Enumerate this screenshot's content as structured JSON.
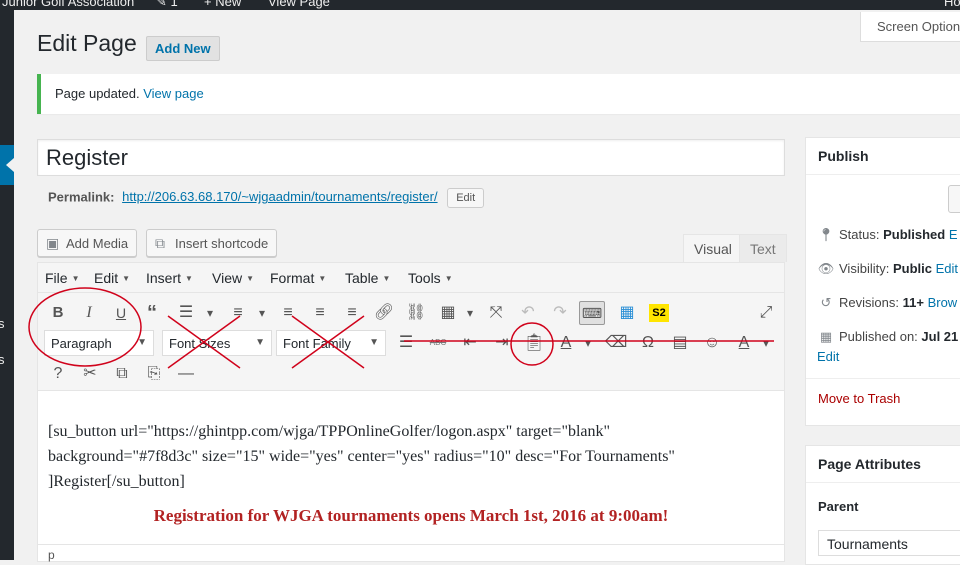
{
  "admin_bar": {
    "site_name": "Junior Golf Association",
    "comments_count": "1",
    "new_label": "New",
    "view_page_label": "View Page",
    "howdy": "Ho"
  },
  "admin_menu": {
    "cut_labels": [
      "s",
      "s"
    ]
  },
  "screen_options": "Screen Options",
  "page": {
    "title": "Edit Page",
    "add_new": "Add New"
  },
  "notice": {
    "text": "Page updated.",
    "link": "View page"
  },
  "post": {
    "title": "Register"
  },
  "permalink": {
    "label": "Permalink:",
    "url": "http://206.63.68.170/~wjgaadmin/tournaments/register/",
    "edit_label": "Edit"
  },
  "media_buttons": {
    "add_media": "Add Media",
    "insert_shortcode": "Insert shortcode"
  },
  "editor_tabs": {
    "visual": "Visual",
    "text": "Text"
  },
  "menubar": [
    "File",
    "Edit",
    "Insert",
    "View",
    "Format",
    "Table",
    "Tools"
  ],
  "toolbar": {
    "paragraph_select": "Paragraph",
    "font_sizes_select": "Font Sizes",
    "font_family_select": "Font Family",
    "s2_label": "S2",
    "strike_label": "ABC",
    "omega": "Ω",
    "text_color_letter": "A"
  },
  "content": {
    "shortcode_text": "[su_button url=\"https://ghintpp.com/wjga/TPPOnlineGolfer/logon.aspx\" target=\"blank\" background=\"#7f8d3c\" size=\"15\" wide=\"yes\" center=\"yes\" radius=\"10\" desc=\"For Tournaments\" ]Register[/su_button]",
    "registration_line": "Registration for WJGA tournaments opens March 1st, 2016 at 9:00am!",
    "path": "p"
  },
  "publish": {
    "title": "Publish",
    "status_label": "Status:",
    "status_value": "Published",
    "status_edit": "E",
    "visibility_label": "Visibility:",
    "visibility_value": "Public",
    "visibility_edit": "Edit",
    "revisions_label": "Revisions:",
    "revisions_value": "11+",
    "revisions_link": "Brow",
    "published_label": "Published on:",
    "published_value": "Jul 21",
    "published_edit": "Edit",
    "trash": "Move to Trash"
  },
  "page_attributes": {
    "title": "Page Attributes",
    "parent_label": "Parent",
    "parent_value": "Tournaments"
  },
  "colors": {
    "admin_dark": "#23282d",
    "link_blue": "#0073aa",
    "notice_green": "#46b450",
    "annotation_red": "#d0021b",
    "registration_red": "#b22222"
  }
}
